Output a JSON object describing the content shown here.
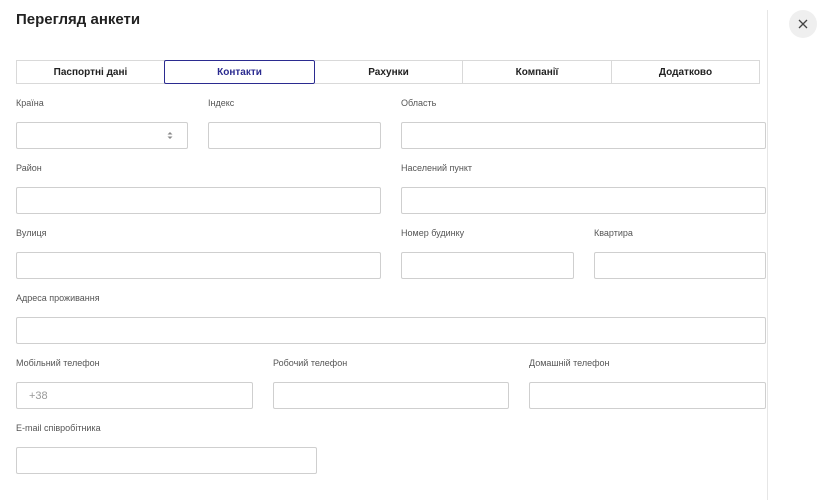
{
  "dialog": {
    "title": "Перегляд анкети"
  },
  "tabs": [
    {
      "label": "Паспортні дані",
      "active": false
    },
    {
      "label": "Контакти",
      "active": true
    },
    {
      "label": "Рахунки",
      "active": false
    },
    {
      "label": "Компанії",
      "active": false
    },
    {
      "label": "Додатково",
      "active": false
    }
  ],
  "form": {
    "country": {
      "label": "Країна",
      "value": ""
    },
    "index": {
      "label": "Індекс",
      "value": ""
    },
    "region": {
      "label": "Область",
      "value": ""
    },
    "district": {
      "label": "Район",
      "value": ""
    },
    "settlement": {
      "label": "Населений пункт",
      "value": ""
    },
    "street": {
      "label": "Вулиця",
      "value": ""
    },
    "house": {
      "label": "Номер будинку",
      "value": ""
    },
    "apartment": {
      "label": "Квартира",
      "value": ""
    },
    "address": {
      "label": "Адреса проживання",
      "value": ""
    },
    "mobile": {
      "label": "Мобільний телефон",
      "placeholder": "+38"
    },
    "work_phone": {
      "label": "Робочий телефон",
      "value": ""
    },
    "home_phone": {
      "label": "Домашній телефон",
      "value": ""
    },
    "email": {
      "label": "E-mail співробітника",
      "value": ""
    }
  },
  "icons": {
    "close": "close-icon",
    "select": "select-arrows-icon"
  }
}
